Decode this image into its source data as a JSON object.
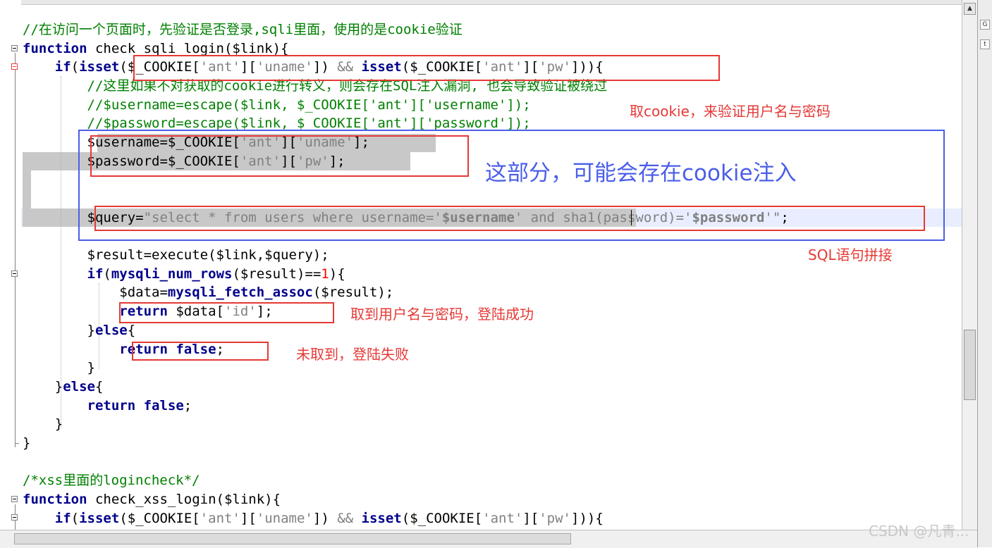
{
  "code_lines": [
    {
      "segments": [
        {
          "t": "//在访问一个页面时，先验证是否登录,sqli里面，使用的是cookie验证",
          "c": "cm"
        }
      ]
    },
    {
      "segments": [
        {
          "t": "function",
          "c": "kw"
        },
        {
          "t": " check_sqli_login($link){",
          "c": "fn"
        }
      ]
    },
    {
      "segments": [
        {
          "t": "    "
        },
        {
          "t": "if",
          "c": "kw"
        },
        {
          "t": "("
        },
        {
          "t": "isset",
          "c": "kw"
        },
        {
          "t": "($_COOKIE["
        },
        {
          "t": "'ant'",
          "c": "st"
        },
        {
          "t": "]["
        },
        {
          "t": "'uname'",
          "c": "st"
        },
        {
          "t": "]) "
        },
        {
          "t": "&&",
          "c": "st"
        },
        {
          "t": " "
        },
        {
          "t": "isset",
          "c": "kw"
        },
        {
          "t": "($_COOKIE["
        },
        {
          "t": "'ant'",
          "c": "st"
        },
        {
          "t": "]["
        },
        {
          "t": "'pw'",
          "c": "st"
        },
        {
          "t": "])){"
        }
      ]
    },
    {
      "segments": [
        {
          "t": "        "
        },
        {
          "t": "//这里如果不对获取的cookie进行转义，则会存在SQL注入漏洞, 也会导致验证被绕过",
          "c": "cm"
        }
      ]
    },
    {
      "segments": [
        {
          "t": "        "
        },
        {
          "t": "//$username=escape($link, $_COOKIE['ant']['username']);",
          "c": "cm"
        }
      ]
    },
    {
      "segments": [
        {
          "t": "        "
        },
        {
          "t": "//$password=escape($link, $_COOKIE['ant']['password']);",
          "c": "cm"
        }
      ]
    },
    {
      "segments": [
        {
          "t": "        $username=$_COOKIE["
        },
        {
          "t": "'ant'",
          "c": "st"
        },
        {
          "t": "]["
        },
        {
          "t": "'uname'",
          "c": "st"
        },
        {
          "t": "];"
        }
      ]
    },
    {
      "segments": [
        {
          "t": "        $password=$_COOKIE["
        },
        {
          "t": "'ant'",
          "c": "st"
        },
        {
          "t": "]["
        },
        {
          "t": "'pw'",
          "c": "st"
        },
        {
          "t": "];"
        }
      ]
    },
    {
      "segments": [
        {
          "t": ""
        }
      ]
    },
    {
      "segments": [
        {
          "t": ""
        }
      ]
    },
    {
      "segments": [
        {
          "t": "        $query="
        },
        {
          "t": "\"select * from users where username='",
          "c": "st"
        },
        {
          "t": "$username",
          "c": "st bold"
        },
        {
          "t": "' and sha1(password)='",
          "c": "st"
        },
        {
          "t": "$password",
          "c": "st bold"
        },
        {
          "t": "'\"",
          "c": "st"
        },
        {
          "t": ";"
        }
      ]
    },
    {
      "segments": [
        {
          "t": ""
        }
      ]
    },
    {
      "segments": [
        {
          "t": "        $result=execute($link,$query);"
        }
      ]
    },
    {
      "segments": [
        {
          "t": "        "
        },
        {
          "t": "if",
          "c": "kw"
        },
        {
          "t": "("
        },
        {
          "t": "mysqli_num_rows",
          "c": "kw"
        },
        {
          "t": "($result)=="
        },
        {
          "t": "1",
          "c": "nu"
        },
        {
          "t": "){"
        }
      ]
    },
    {
      "segments": [
        {
          "t": "            $data="
        },
        {
          "t": "mysqli_fetch_assoc",
          "c": "kw"
        },
        {
          "t": "($result);"
        }
      ]
    },
    {
      "segments": [
        {
          "t": "            "
        },
        {
          "t": "return",
          "c": "kw"
        },
        {
          "t": " $data["
        },
        {
          "t": "'id'",
          "c": "st"
        },
        {
          "t": "];"
        }
      ]
    },
    {
      "segments": [
        {
          "t": "        }"
        },
        {
          "t": "else",
          "c": "kw"
        },
        {
          "t": "{"
        }
      ]
    },
    {
      "segments": [
        {
          "t": "            "
        },
        {
          "t": "return false",
          "c": "kw"
        },
        {
          "t": ";"
        }
      ]
    },
    {
      "segments": [
        {
          "t": "        }"
        }
      ]
    },
    {
      "segments": [
        {
          "t": "    }"
        },
        {
          "t": "else",
          "c": "kw"
        },
        {
          "t": "{"
        }
      ]
    },
    {
      "segments": [
        {
          "t": "        "
        },
        {
          "t": "return false",
          "c": "kw"
        },
        {
          "t": ";"
        }
      ]
    },
    {
      "segments": [
        {
          "t": "    }"
        }
      ]
    },
    {
      "segments": [
        {
          "t": "}"
        }
      ]
    },
    {
      "segments": [
        {
          "t": ""
        }
      ]
    },
    {
      "segments": [
        {
          "t": "/*xss里面的logincheck*/",
          "c": "cm"
        }
      ]
    },
    {
      "segments": [
        {
          "t": "function",
          "c": "kw"
        },
        {
          "t": " check_xss_login($link){"
        }
      ]
    },
    {
      "segments": [
        {
          "t": "    "
        },
        {
          "t": "if",
          "c": "kw"
        },
        {
          "t": "("
        },
        {
          "t": "isset",
          "c": "kw"
        },
        {
          "t": "($_COOKIE["
        },
        {
          "t": "'ant'",
          "c": "st"
        },
        {
          "t": "]["
        },
        {
          "t": "'uname'",
          "c": "st"
        },
        {
          "t": "]) "
        },
        {
          "t": "&&",
          "c": "st"
        },
        {
          "t": " "
        },
        {
          "t": "isset",
          "c": "kw"
        },
        {
          "t": "($_COOKIE["
        },
        {
          "t": "'ant'",
          "c": "st"
        },
        {
          "t": "]["
        },
        {
          "t": "'pw'",
          "c": "st"
        },
        {
          "t": "])){"
        }
      ]
    }
  ],
  "annotations": {
    "cookie_check": "取cookie，来验证用户名与密码",
    "injection_note": "这部分，可能会存在cookie注入",
    "sql_concat": "SQL语句拼接",
    "login_success": "取到用户名与密码，登陆成功",
    "login_fail": "未取到，登陆失败"
  },
  "watermark": "CSDN @凡青...",
  "scrollbar": {
    "up_arrow": "▲"
  },
  "right_panel": {
    "item1": "G",
    "item2": "t"
  },
  "colors": {
    "comment": "#008000",
    "keyword": "#00008b",
    "string": "#808080",
    "number": "#ff0000",
    "annotation_red": "#e53935",
    "annotation_blue": "#4a5ee8"
  }
}
